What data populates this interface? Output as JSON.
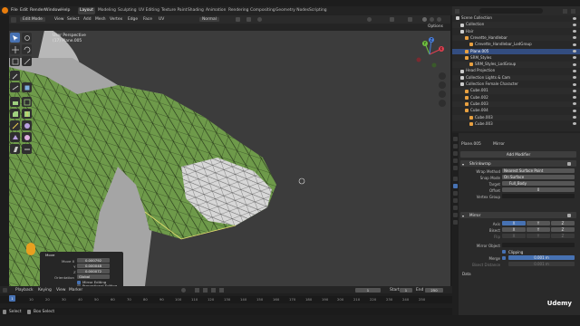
{
  "top_menu": [
    "File",
    "Edit",
    "Render",
    "Window",
    "Help"
  ],
  "workspaces": [
    "Layout",
    "Modeling",
    "Sculpting",
    "UV Editing",
    "Texture Paint",
    "Shading",
    "Animation",
    "Rendering",
    "Compositing",
    "Geometry Nodes",
    "Scripting"
  ],
  "active_workspace": "Layout",
  "scene_label": "Scene",
  "viewlayer_label": "ViewLayer",
  "viewport_header": {
    "mode": "Edit Mode",
    "items": [
      "View",
      "Select",
      "Add",
      "Mesh",
      "Vertex",
      "Edge",
      "Face",
      "UV"
    ],
    "transform": "Normal",
    "options": "Options"
  },
  "viewport_info": {
    "line1": "User Perspective",
    "line2": "(17) Plane.005"
  },
  "gizmo": {
    "x": "X",
    "y": "Y",
    "z": "Z"
  },
  "operator_panel": {
    "title": "Move",
    "rows": [
      {
        "label": "Move X",
        "value": "0.000792"
      },
      {
        "label": "Y",
        "value": "0.000048"
      },
      {
        "label": "Z",
        "value": "0.000072"
      }
    ],
    "orientation_label": "Orientation",
    "orientation_value": "Global",
    "checks": [
      "Mirror Editing",
      "Proportional Editing",
      "Project Individual Elem..."
    ]
  },
  "timeline": {
    "menus": [
      "Playback",
      "Keying",
      "View",
      "Marker"
    ],
    "ticks": [
      "10",
      "20",
      "30",
      "40",
      "50",
      "60",
      "70",
      "80",
      "90",
      "100",
      "110",
      "120",
      "130",
      "140",
      "150",
      "160",
      "170",
      "180",
      "190",
      "200",
      "210",
      "220",
      "230",
      "240",
      "250"
    ],
    "current_frame": "1",
    "start_label": "Start",
    "start": "1",
    "end_label": "End",
    "end": "250"
  },
  "status": {
    "left": "Select",
    "middle": "Box Select"
  },
  "outliner": {
    "rows": [
      {
        "name": "Scene Collection",
        "indent": 0
      },
      {
        "name": "Collection",
        "indent": 1
      },
      {
        "name": "Hair",
        "indent": 1
      },
      {
        "name": "Crevette_Handlebar",
        "indent": 2
      },
      {
        "name": "Crevette_Handlebar_LodGroup",
        "indent": 3
      },
      {
        "name": "Plane.005",
        "indent": 2,
        "selected": true
      },
      {
        "name": "SRM_Styles",
        "indent": 2
      },
      {
        "name": "SRM_Styles_LodGroup",
        "indent": 3
      },
      {
        "name": "Head Projection",
        "indent": 1
      },
      {
        "name": "Collection Lights & Cam",
        "indent": 1
      },
      {
        "name": "Collection Female Character",
        "indent": 1
      },
      {
        "name": "Cube.001",
        "indent": 2
      },
      {
        "name": "Cube.002",
        "indent": 2
      },
      {
        "name": "Cube.003",
        "indent": 2
      },
      {
        "name": "Cube.004",
        "indent": 2
      },
      {
        "name": "Cube.003",
        "indent": 3
      },
      {
        "name": "Cube.003",
        "indent": 3
      }
    ]
  },
  "properties": {
    "object_name": "Plane.005",
    "modifier_tab": "Mirror",
    "add_modifier": "Add Modifier",
    "shrinkwrap": {
      "name": "Shrinkwrap",
      "wrap_method_label": "Wrap Method",
      "wrap_method": "Nearest Surface Point",
      "snap_mode_label": "Snap Mode",
      "snap_mode": "On Surface",
      "target_label": "Target",
      "target": "Full_Body",
      "offset_label": "Offset",
      "offset": "0",
      "vertex_group_label": "Vertex Group"
    },
    "mirror": {
      "name": "Mirror",
      "axis_label": "Axis",
      "bisect_label": "Bisect",
      "flip_label": "Flip",
      "axes": [
        "X",
        "Y",
        "Z"
      ],
      "mirror_object_label": "Mirror Object",
      "clipping_label": "Clipping",
      "merge_label": "Merge",
      "merge_value": "0.001 m",
      "bisect_distance_label": "Bisect Distance",
      "bisect_distance": "0.001 m",
      "data_label": "Data"
    }
  },
  "watermark": "Udemy",
  "colors": {
    "accent": "#4772b3",
    "mesh_green": "#6e9a4a",
    "viewport_bg": "#3c3c3c"
  }
}
